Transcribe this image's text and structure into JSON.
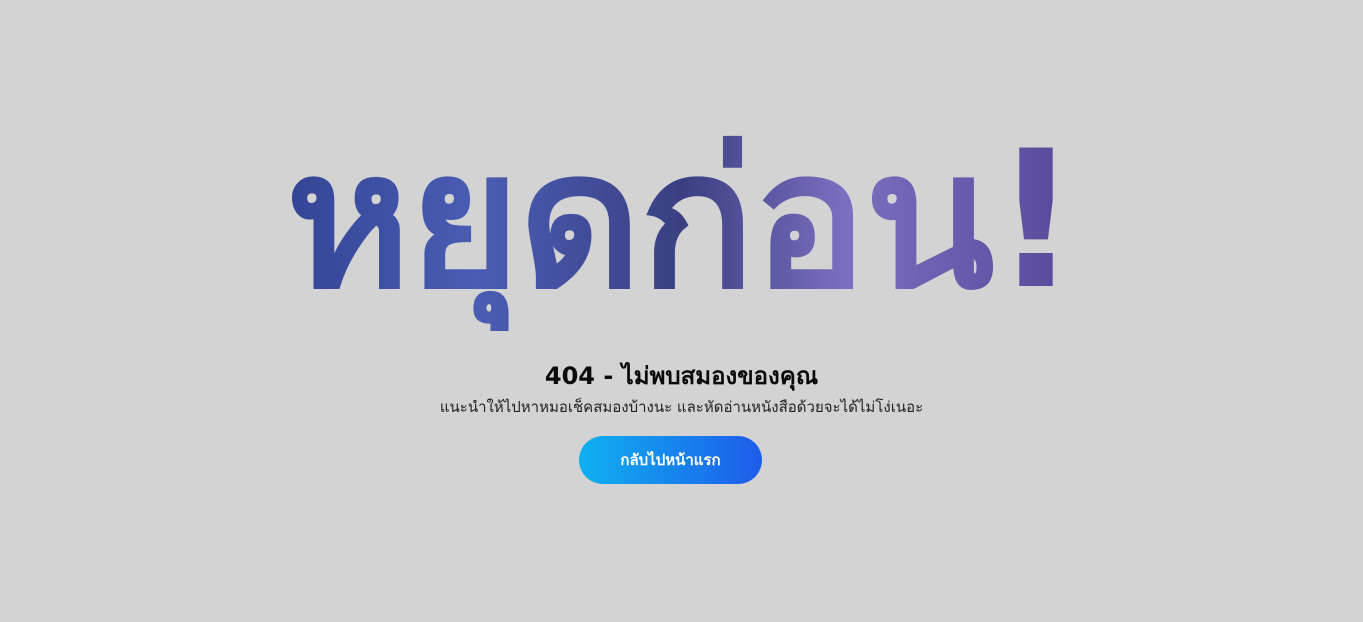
{
  "hero": {
    "title": "หยุดก่อน!"
  },
  "error": {
    "heading": "404 - ไม่พบสมองของคุณ",
    "message": "แนะนำให้ไปหาหมอเช็คสมองบ้างนะ และหัดอ่านหนังสือด้วยจะได้ไม่โง่เนอะ"
  },
  "actions": {
    "home_label": "กลับไปหน้าแรก"
  },
  "colors": {
    "background": "#d3d3d3",
    "button_gradient_start": "#0fb0f0",
    "button_gradient_end": "#1e5cea",
    "hero_primary": "#3f4c98"
  }
}
